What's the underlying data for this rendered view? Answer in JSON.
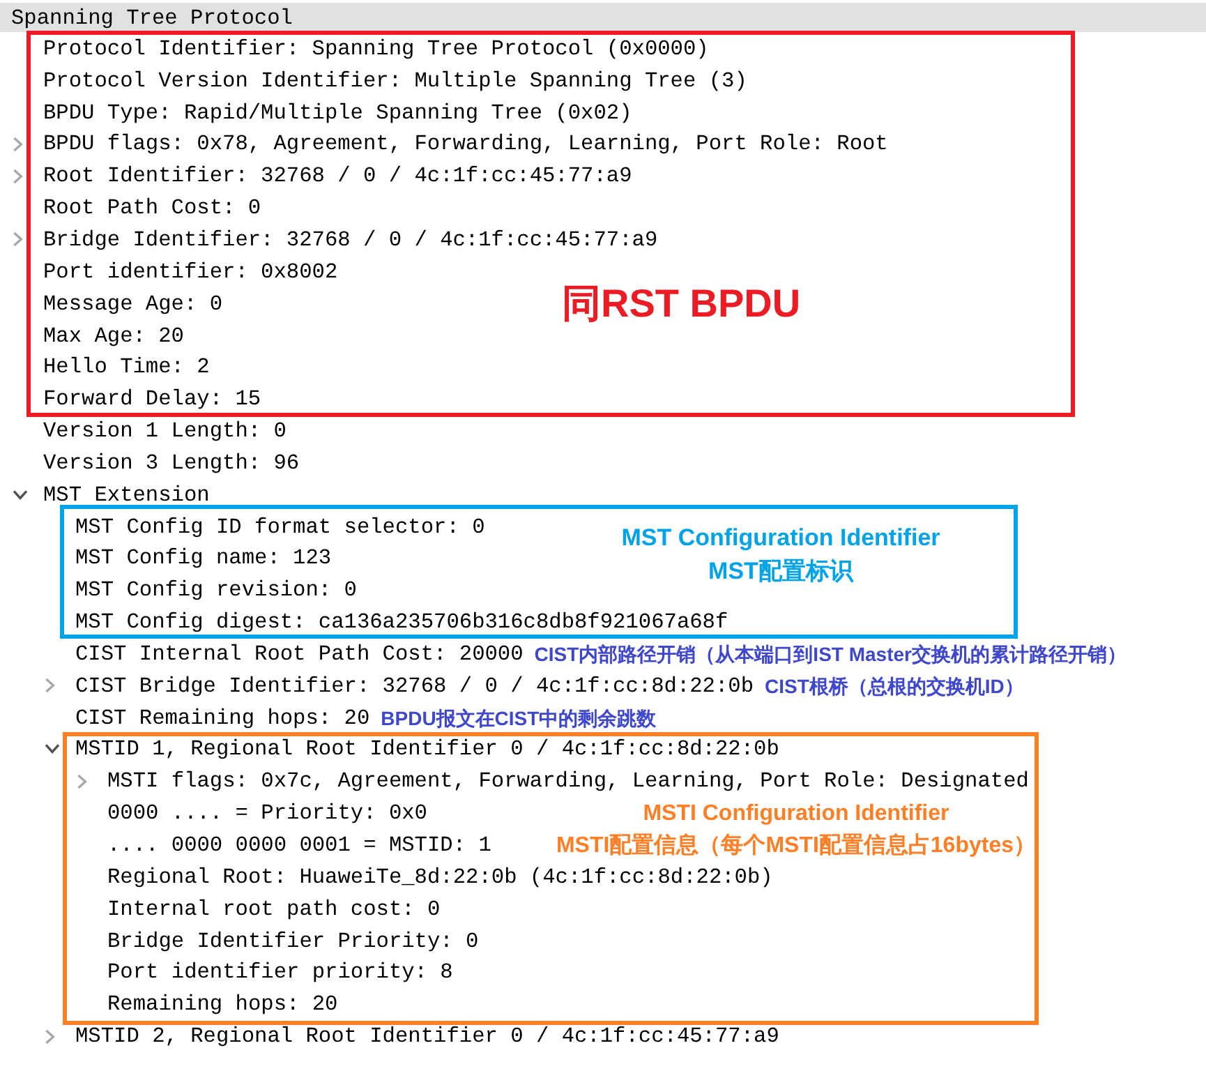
{
  "header": "Spanning Tree Protocol",
  "tree": [
    {
      "kind": "callout",
      "color": "#ed1c24",
      "notes": [
        "同RST BPDU"
      ],
      "rows": [
        {
          "kind": "leaf",
          "label": "Protocol Identifier: Spanning Tree Protocol (0x0000)"
        },
        {
          "kind": "leaf",
          "label": "Protocol Version Identifier: Multiple Spanning Tree (3)"
        },
        {
          "kind": "leaf",
          "label": "BPDU Type: Rapid/Multiple Spanning Tree (0x02)"
        },
        {
          "kind": "branch",
          "label": "BPDU flags: 0x78, Agreement, Forwarding, Learning, Port Role: Root",
          "expanded": false
        },
        {
          "kind": "branch",
          "label": "Root Identifier: 32768 / 0 / 4c:1f:cc:45:77:a9",
          "expanded": false
        },
        {
          "kind": "leaf",
          "label": "Root Path Cost: 0"
        },
        {
          "kind": "branch",
          "label": "Bridge Identifier: 32768 / 0 / 4c:1f:cc:45:77:a9",
          "expanded": false
        },
        {
          "kind": "leaf",
          "label": "Port identifier: 0x8002"
        },
        {
          "kind": "leaf",
          "label": "Message Age: 0"
        },
        {
          "kind": "leaf",
          "label": "Max Age: 20"
        },
        {
          "kind": "leaf",
          "label": "Hello Time: 2"
        },
        {
          "kind": "leaf",
          "label": "Forward Delay: 15"
        }
      ]
    },
    {
      "kind": "leaf",
      "label": "Version 1 Length: 0"
    },
    {
      "kind": "leaf",
      "label": "Version 3 Length: 96"
    },
    {
      "kind": "branch",
      "label": "MST Extension",
      "expanded": true,
      "children": [
        {
          "kind": "callout",
          "color": "#00a2e8",
          "notes": [
            "MST Configuration Identifier",
            "MST配置标识"
          ],
          "rows": [
            {
              "kind": "leaf",
              "label": "MST Config ID format selector: 0"
            },
            {
              "kind": "leaf",
              "label": "MST Config name: 123"
            },
            {
              "kind": "leaf",
              "label": "MST Config revision: 0"
            },
            {
              "kind": "leaf",
              "label": "MST Config digest: ca136a235706b316c8db8f921067a68f"
            }
          ]
        },
        {
          "kind": "leaf",
          "label": "CIST Internal Root Path Cost: 20000",
          "note": {
            "text": "CIST内部路径开销（从本端口到IST Master交换机的累计路径开销）",
            "color": "#3f48cc"
          }
        },
        {
          "kind": "branch",
          "label": "CIST Bridge Identifier: 32768 / 0 / 4c:1f:cc:8d:22:0b",
          "expanded": false,
          "note": {
            "text": "CIST根桥（总根的交换机ID）",
            "color": "#3f48cc"
          }
        },
        {
          "kind": "leaf",
          "label": "CIST Remaining hops: 20",
          "note": {
            "text": "BPDU报文在CIST中的剩余跳数",
            "color": "#3f48cc"
          }
        },
        {
          "kind": "callout",
          "color": "#ff7f27",
          "notes": [
            "MSTI Configuration Identifier",
            "MSTI配置信息（每个MSTI配置信息占16bytes）"
          ],
          "rows": [
            {
              "kind": "branch",
              "label": "MSTID 1, Regional Root Identifier 0 / 4c:1f:cc:8d:22:0b",
              "expanded": true,
              "children": [
                {
                  "kind": "branch",
                  "label": "MSTI flags: 0x7c, Agreement, Forwarding, Learning, Port Role: Designated",
                  "expanded": false
                },
                {
                  "kind": "leaf",
                  "label": "0000 .... = Priority: 0x0"
                },
                {
                  "kind": "leaf",
                  "label": ".... 0000 0000 0001 = MSTID: 1"
                },
                {
                  "kind": "leaf",
                  "label": "Regional Root: HuaweiTe_8d:22:0b (4c:1f:cc:8d:22:0b)"
                },
                {
                  "kind": "leaf",
                  "label": "Internal root path cost: 0"
                },
                {
                  "kind": "leaf",
                  "label": "Bridge Identifier Priority: 0"
                },
                {
                  "kind": "leaf",
                  "label": "Port identifier priority: 8"
                },
                {
                  "kind": "leaf",
                  "label": "Remaining hops: 20"
                }
              ]
            }
          ]
        },
        {
          "kind": "branch",
          "label": "MSTID 2, Regional Root Identifier 0 / 4c:1f:cc:45:77:a9",
          "expanded": false
        }
      ]
    }
  ]
}
